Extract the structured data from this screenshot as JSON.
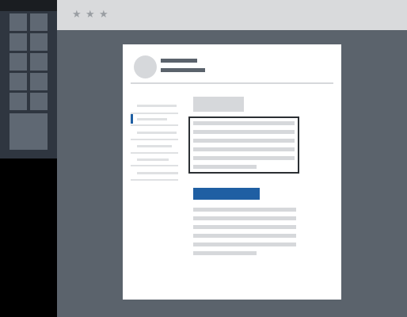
{
  "window": {
    "titlebar_controls": [
      "★",
      "★",
      "★"
    ]
  },
  "icons": {
    "titlebar_star": "star-icon",
    "avatar": "avatar-placeholder"
  },
  "colors": {
    "accent": "#1f5fa3",
    "window_bg": "#5b636c",
    "titlebar_bg": "#d9dadc",
    "page_bg": "#ffffff",
    "focus_border": "#2b2f33"
  },
  "navigation": {
    "selected_index": 1,
    "item_count": 6
  }
}
